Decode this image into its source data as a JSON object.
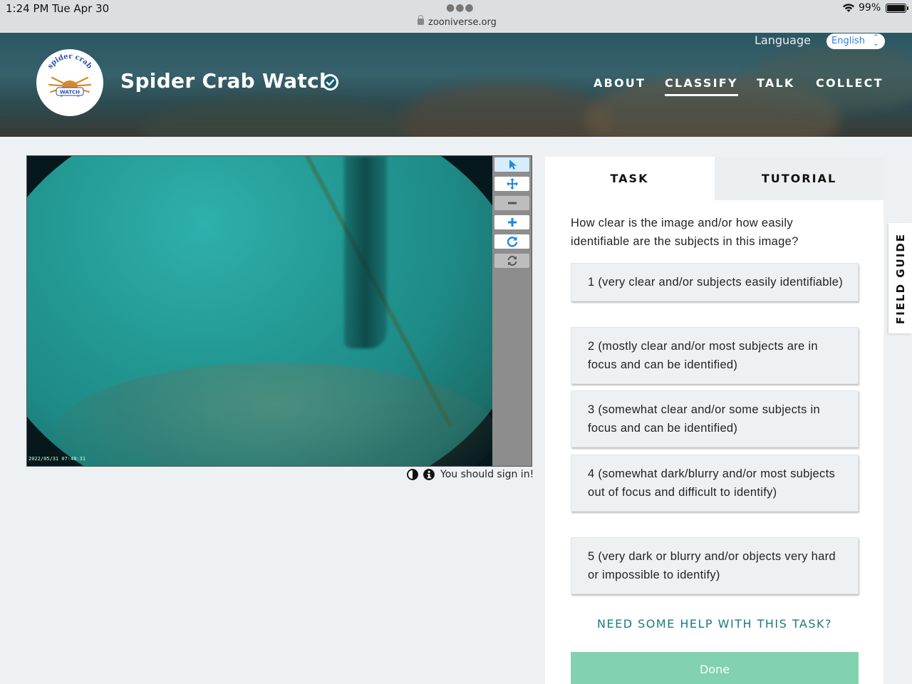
{
  "status_bar": {
    "time": "1:24 PM",
    "date": "Tue Apr 30",
    "url": "zooniverse.org",
    "battery": "99%"
  },
  "header": {
    "language_label": "Language",
    "language_value": "English",
    "project_title": "Spider Crab Watch",
    "logo_text_top": "spider crab",
    "logo_text_bottom": "WATCH",
    "nav": {
      "about": "ABOUT",
      "classify": "CLASSIFY",
      "talk": "TALK",
      "collect": "COLLECT"
    }
  },
  "viewer": {
    "timestamp": "2022/05/31 07:48:31",
    "sign_in_message": "You should sign in!"
  },
  "task_panel": {
    "tabs": {
      "task": "TASK",
      "tutorial": "TUTORIAL"
    },
    "question": "How clear is the image and/or how easily identifiable are the subjects in this image?",
    "answers": [
      "1 (very clear and/or subjects easily identifiable)",
      "2 (mostly clear and/or most subjects are in focus and can be identified)",
      "3 (somewhat clear and/or some subjects in focus and can be identified)",
      "4 (somewhat dark/blurry and/or most subjects out of focus and difficult to identify)",
      "5 (very dark or blurry and/or objects very hard or impossible to identify)"
    ],
    "help_link": "NEED SOME HELP WITH THIS TASK?",
    "done_label": "Done"
  },
  "field_guide_label": "FIELD GUIDE",
  "colors": {
    "accent_blue": "#1e88e5",
    "done_green": "#82d2b1",
    "help_teal": "#1a7a7f"
  }
}
